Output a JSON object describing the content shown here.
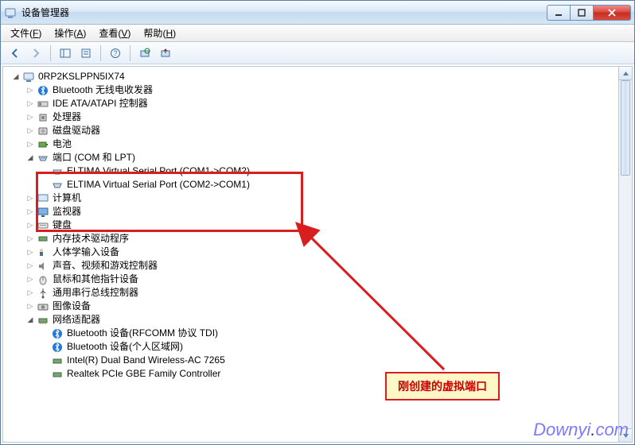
{
  "window": {
    "title": "设备管理器"
  },
  "menubar": {
    "file": {
      "label": "文件",
      "hotkey": "F"
    },
    "action": {
      "label": "操作",
      "hotkey": "A"
    },
    "view": {
      "label": "查看",
      "hotkey": "V"
    },
    "help": {
      "label": "帮助",
      "hotkey": "H"
    }
  },
  "tree": {
    "root": {
      "label": "0RP2KSLPPN5IX74"
    },
    "items": [
      {
        "key": "bluetooth_radio",
        "label": "Bluetooth 无线电收发器"
      },
      {
        "key": "ide",
        "label": "IDE ATA/ATAPI 控制器"
      },
      {
        "key": "cpu",
        "label": "处理器"
      },
      {
        "key": "disk",
        "label": "磁盘驱动器"
      },
      {
        "key": "battery",
        "label": "电池"
      },
      {
        "key": "ports",
        "label": "端口 (COM 和 LPT)",
        "expanded": true,
        "children": [
          {
            "key": "vsp1",
            "label": "ELTIMA Virtual Serial Port (COM1->COM2)"
          },
          {
            "key": "vsp2",
            "label": "ELTIMA Virtual Serial Port (COM2->COM1)"
          }
        ]
      },
      {
        "key": "computer",
        "label": "计算机"
      },
      {
        "key": "monitor",
        "label": "监视器"
      },
      {
        "key": "keyboard",
        "label": "键盘"
      },
      {
        "key": "memtech",
        "label": "内存技术驱动程序"
      },
      {
        "key": "hid",
        "label": "人体学输入设备"
      },
      {
        "key": "sound",
        "label": "声音、视频和游戏控制器"
      },
      {
        "key": "mouse",
        "label": "鼠标和其他指针设备"
      },
      {
        "key": "usb",
        "label": "通用串行总线控制器"
      },
      {
        "key": "imaging",
        "label": "图像设备"
      },
      {
        "key": "network",
        "label": "网络适配器",
        "expanded": true,
        "children": [
          {
            "key": "net_bt_rfcomm",
            "label": "Bluetooth 设备(RFCOMM 协议 TDI)"
          },
          {
            "key": "net_bt_pan",
            "label": "Bluetooth 设备(个人区域网)"
          },
          {
            "key": "net_intel",
            "label": "Intel(R) Dual Band Wireless-AC 7265"
          },
          {
            "key": "net_realtek",
            "label": "Realtek PCIe GBE Family Controller"
          }
        ]
      }
    ]
  },
  "callout": {
    "text": "刚创建的虚拟端口"
  },
  "watermark": {
    "text_a": "Downyi",
    "text_b": "com"
  }
}
